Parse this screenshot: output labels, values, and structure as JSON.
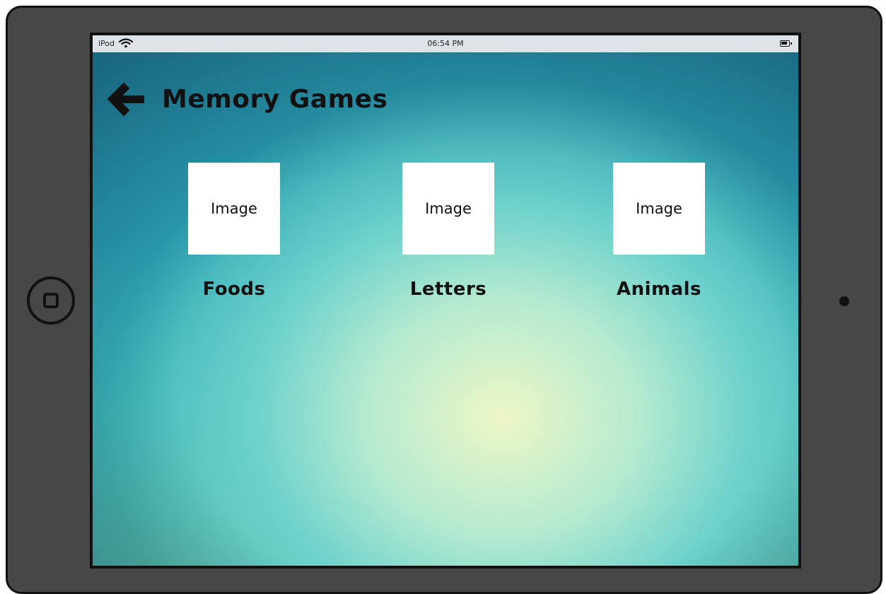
{
  "status_bar": {
    "device": "iPod",
    "time": "06:54 PM",
    "wifi_icon": "wifi-icon",
    "battery_icon": "battery-icon"
  },
  "header": {
    "back_icon": "arrow-left-icon",
    "title": "Memory Games"
  },
  "games": [
    {
      "image_placeholder": "Image",
      "label": "Foods"
    },
    {
      "image_placeholder": "Image",
      "label": "Letters"
    },
    {
      "image_placeholder": "Image",
      "label": "Animals"
    }
  ],
  "colors": {
    "device_frame": "#474747",
    "screen_center": "#eef7c6",
    "screen_edge": "#1f7f97",
    "text": "#111111"
  }
}
